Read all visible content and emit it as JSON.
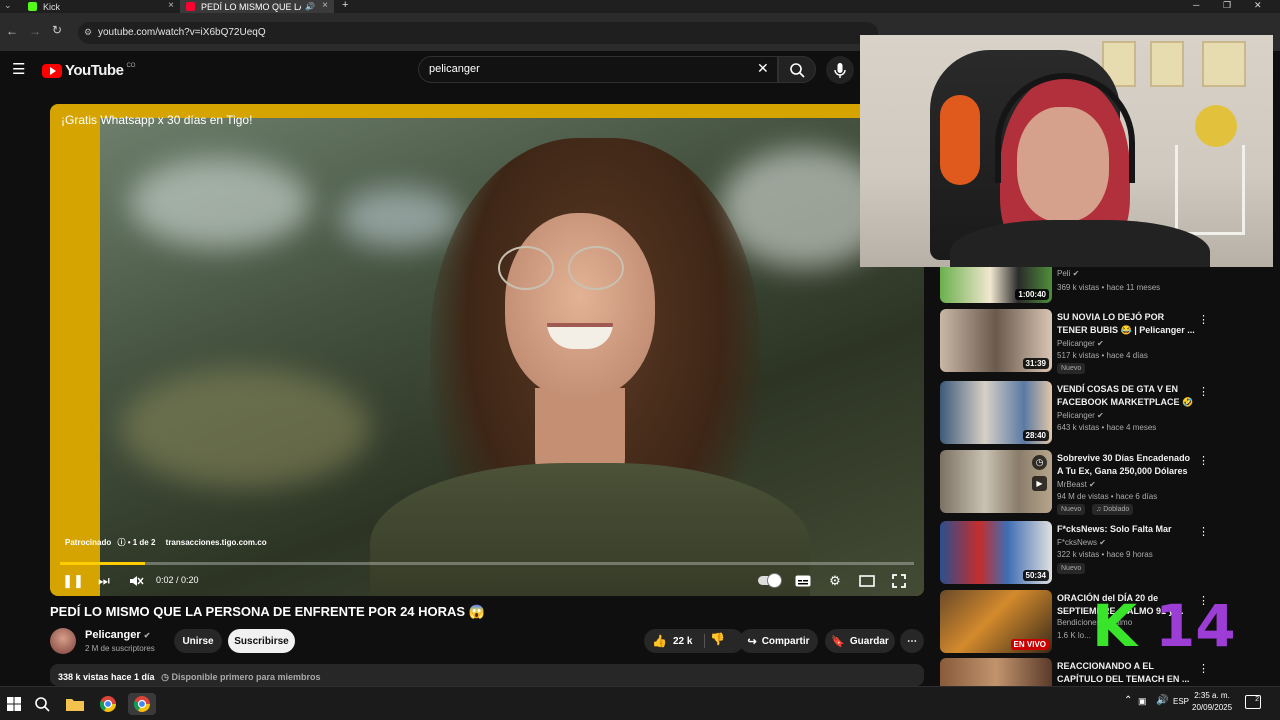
{
  "browser": {
    "tabs": [
      {
        "label": "Kick",
        "color": "#53fc18"
      },
      {
        "label": "PEDÍ LO MISMO QUE LA PE",
        "color": "#ff0033"
      }
    ],
    "url": "youtube.com/watch?v=iX6bQ72UeqQ",
    "window_buttons": [
      "─",
      "❐",
      "✕"
    ]
  },
  "youtube": {
    "logo": "YouTube",
    "region": "CO",
    "search_value": "pelicanger"
  },
  "player": {
    "ad_title": "¡Gratis Whatsapp x 30 días en Tigo!",
    "ad_sponsored": "Patrocinado",
    "ad_count": "1 de 2",
    "ad_domain": "transacciones.tigo.com.co",
    "timecode": "0:02 / 0:20",
    "progress": 0.1,
    "ad_accent": "#ffcc00"
  },
  "video": {
    "title": "PEDÍ LO MISMO QUE LA PERSONA DE ENFRENTE POR 24 HORAS 😱",
    "channel": "Pelicanger",
    "subscribers": "2 M de suscriptores",
    "join_label": "Unirse",
    "subscribe_label": "Suscribirse",
    "likes": "22 k",
    "share_label": "Compartir",
    "save_label": "Guardar",
    "views_date": "338 k vistas  hace 1 día",
    "members_note": "Disponible primero para miembros"
  },
  "related": [
    {
      "title": "",
      "channel": "Peli",
      "meta": "369 k vistas • hace 11 meses",
      "duration": "1:00:40",
      "badges": []
    },
    {
      "title": "SU NOVIA LO DEJÓ POR TENER BUBIS 😂 | Pelicanger ...",
      "channel": "Pelicanger",
      "meta": "517 k vistas • hace 4 días",
      "duration": "31:39",
      "badges": [
        "Nuevo"
      ]
    },
    {
      "title": "VENDÍ COSAS DE GTA V EN FACEBOOK MARKETPLACE 🤣",
      "channel": "Pelicanger",
      "meta": "643 k vistas • hace 4 meses",
      "duration": "28:40",
      "badges": []
    },
    {
      "title": "Sobrevive 30 Días Encadenado A Tu Ex, Gana 250,000 Dólares",
      "channel": "MrBeast",
      "meta": "94 M de vistas • hace 6 días",
      "duration": "",
      "badges": [
        "Nuevo",
        "Doblado"
      ]
    },
    {
      "title": "F*cksNews: Solo Falta Mar",
      "channel": "F*cksNews",
      "meta": "322 k vistas • hace 9 horas",
      "duration": "50:34",
      "badges": [
        "Nuevo"
      ]
    },
    {
      "title": "ORACIÓN del DÍA 20 de SEPTIEMBRE -SALMO 91 y ...",
      "channel": "Bendiciones... Salmo",
      "meta": "1.6 K lo...",
      "duration": "EN VIVO",
      "badges": []
    },
    {
      "title": "REACCIONANDO A EL CAPÍTULO DEL TEMACH EN ...",
      "channel": "",
      "meta": "",
      "duration": "",
      "badges": []
    }
  ],
  "watermark": {
    "k": "K",
    "num": "14"
  },
  "taskbar": {
    "lang": "ESP",
    "time": "2:35 a. m.",
    "date": "20/09/2025",
    "notifications": "2"
  }
}
